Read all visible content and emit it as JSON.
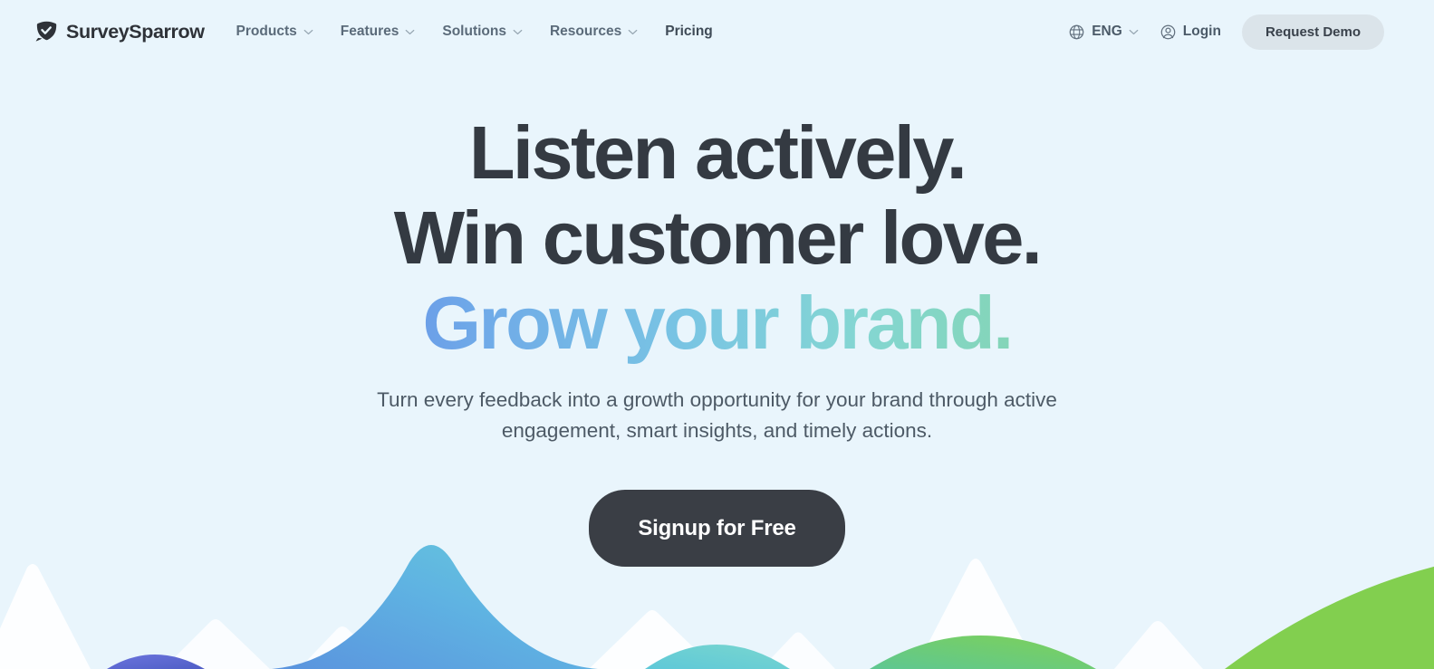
{
  "page": {
    "background_color": "#e9f5fc"
  },
  "header": {
    "brand": {
      "name": "SurveySparrow",
      "logo_icon": "sparrow-shield-check-icon"
    },
    "nav_items": [
      {
        "label": "Products",
        "has_dropdown": true,
        "icon": "chevron-down-icon"
      },
      {
        "label": "Features",
        "has_dropdown": true,
        "icon": "chevron-down-icon"
      },
      {
        "label": "Solutions",
        "has_dropdown": true,
        "icon": "chevron-down-icon"
      },
      {
        "label": "Resources",
        "has_dropdown": true,
        "icon": "chevron-down-icon"
      },
      {
        "label": "Pricing",
        "has_dropdown": false,
        "icon": ""
      }
    ],
    "language": {
      "label": "ENG",
      "icon": "globe-icon",
      "chevron": "chevron-down-icon"
    },
    "login": {
      "label": "Login",
      "icon": "user-circle-icon"
    },
    "demo_button": {
      "label": "Request Demo",
      "background_color": "#dbe4ea",
      "text_color": "#39414b"
    }
  },
  "hero": {
    "headline_line1": "Listen actively.",
    "headline_line2": "Win customer love.",
    "headline_line3": "Grow your brand.",
    "headline_color": "#343a42",
    "gradient_start_color": "#5a62e0",
    "gradient_mid_color": "#79c5e3",
    "gradient_end_color": "#74c878",
    "subtitle_line1": "Turn every feedback into a growth opportunity for your brand through",
    "subtitle_line2": "active engagement, smart insights, and timely actions.",
    "cta": {
      "label": "Signup for Free",
      "background_color": "#3a3e45",
      "text_color": "#ffffff"
    }
  },
  "landscape": {
    "description": "decorative layered mountain range illustration",
    "hills": [
      {
        "name": "white-peak-left",
        "color": "#fdfeff"
      },
      {
        "name": "indigo-hill-left",
        "color": "#5f6dd4"
      },
      {
        "name": "blue-mountain-center",
        "color_start": "#5b9fe0",
        "color_end": "#64c8da"
      },
      {
        "name": "white-peak-center",
        "color": "#fdfeff"
      },
      {
        "name": "teal-hill-center-right",
        "color": "#64cddb"
      },
      {
        "name": "white-peak-right",
        "color": "#fdfeff"
      },
      {
        "name": "green-hill-right",
        "color_start": "#63c98f",
        "color_end": "#7ed158"
      },
      {
        "name": "green-hill-far-right",
        "color": "#82cf4f"
      }
    ]
  }
}
